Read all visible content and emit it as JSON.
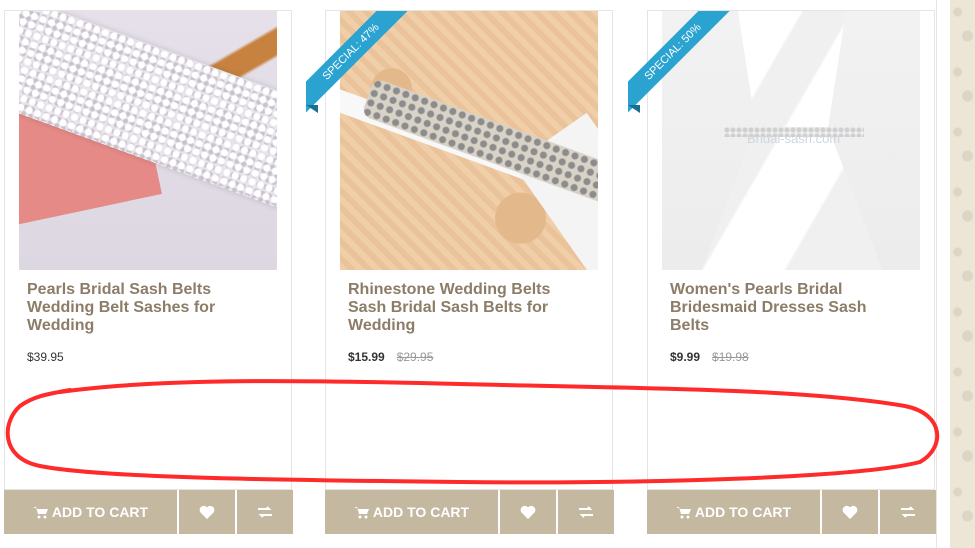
{
  "products": [
    {
      "title_lines": [
        "Pearls Bridal Sash Belts",
        "Wedding Belt Sashes for",
        "Wedding"
      ],
      "price": "$39.95",
      "old_price": "",
      "badge": "",
      "image_alt": "pearls-bridal-sash-belt-photo"
    },
    {
      "title_lines": [
        "Rhinestone Wedding Belts",
        "Sash Bridal Sash Belts for",
        "Wedding"
      ],
      "price": "$15.99",
      "old_price": "$29.95",
      "badge": "SPECIAL: 47%",
      "image_alt": "rhinestone-wedding-belt-photo"
    },
    {
      "title_lines": [
        "Women's Pearls Bridal",
        "Bridesmaid Dresses Sash",
        "Belts"
      ],
      "price": "$9.99",
      "old_price": "$19.98",
      "badge": "SPECIAL: 50%",
      "image_alt": "womens-pearls-bridal-sash-photo",
      "watermark": "Bridal-sash.com"
    }
  ],
  "actions": {
    "add_to_cart_label": "ADD TO CART",
    "wishlist_icon": "heart-icon",
    "compare_icon": "compare-arrows-icon",
    "cart_icon": "cart-icon"
  },
  "colors": {
    "button_bg": "#c4b8a1",
    "title": "#8c7d68",
    "badge": "#2aa3d1",
    "annotation": "#ff2a2a"
  }
}
